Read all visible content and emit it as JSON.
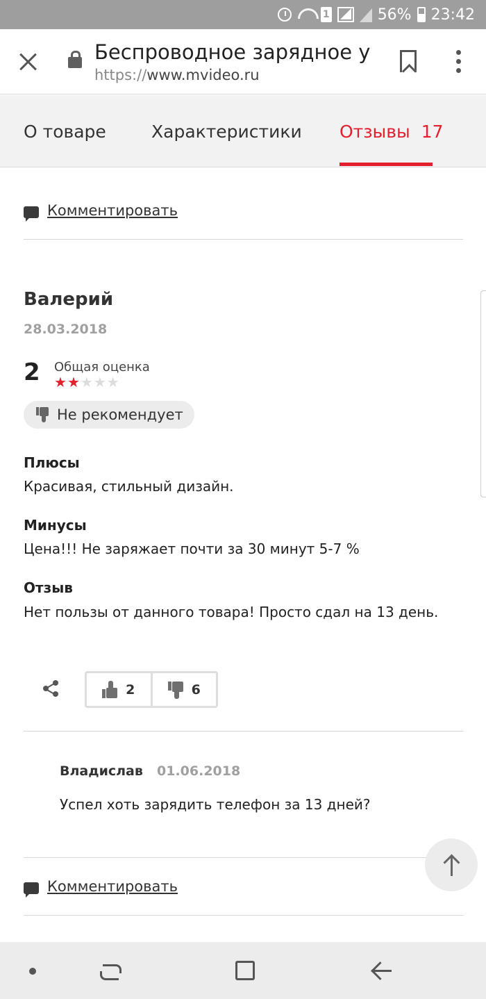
{
  "status_bar": {
    "sim_label": "1",
    "battery": "56%",
    "time": "23:42"
  },
  "browser": {
    "page_title": "Беспроводное зарядное у...",
    "url_scheme": "https://",
    "url_host": "www.mvideo.ru"
  },
  "tabs": [
    {
      "label": "О товаре"
    },
    {
      "label": "Характеристики"
    },
    {
      "label": "Отзывы",
      "count": "17",
      "active": true
    }
  ],
  "comment_link_label": "Комментировать",
  "review": {
    "author": "Валерий",
    "date": "28.03.2018",
    "rating_value": "2",
    "rating_label": "Общая оценка",
    "rating_stars": 2,
    "rating_max": 5,
    "recommendation": "Не рекомендует",
    "pros_title": "Плюсы",
    "pros_text": "Красивая, стильный дизайн.",
    "cons_title": "Минусы",
    "cons_text": "Цена!!! Не заряжает почти за 30 минут 5-7 %",
    "review_title": "Отзыв",
    "review_text": "Нет пользы от данного товара! Просто сдал на 13 день.",
    "likes": "2",
    "dislikes": "6"
  },
  "reply": {
    "author": "Владислав",
    "date": "01.06.2018",
    "text": "Успел хоть зарядить телефон за 13 дней?"
  },
  "colors": {
    "accent": "#e4202e",
    "muted_text": "#a0a0a0",
    "divider": "#d6d6d6"
  }
}
